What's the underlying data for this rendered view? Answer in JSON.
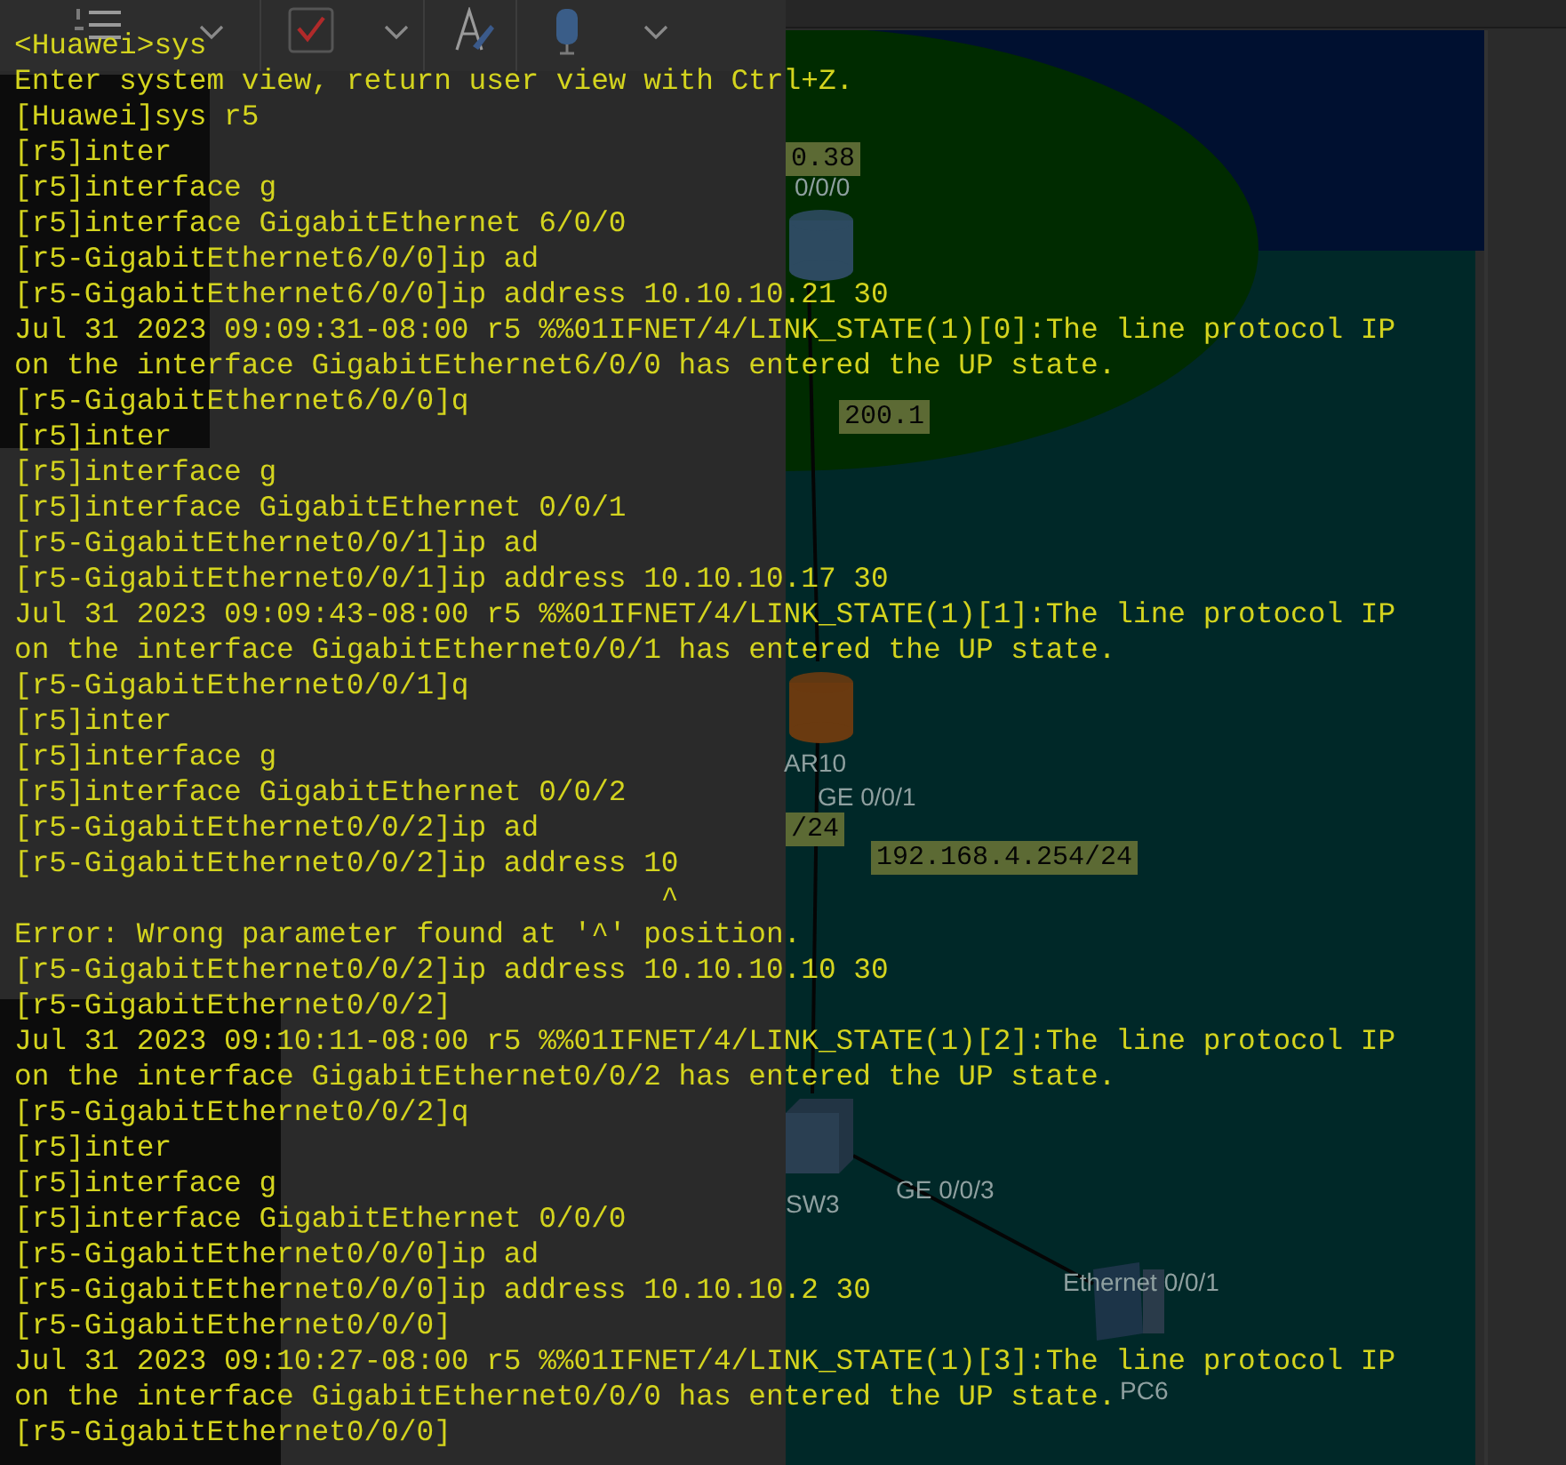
{
  "toolbar": {
    "items": [
      {
        "kind": "numbered-list"
      },
      {
        "kind": "caret"
      },
      {
        "kind": "checkbox"
      },
      {
        "kind": "caret"
      },
      {
        "kind": "brush"
      },
      {
        "kind": "microphone"
      },
      {
        "kind": "caret"
      }
    ]
  },
  "diagram": {
    "nodes": [
      {
        "kind": "router"
      },
      {
        "kind": "router"
      },
      {
        "kind": "switch"
      },
      {
        "kind": "pc"
      }
    ],
    "labels": [
      {
        "text": "0.38",
        "kind": "address"
      },
      {
        "text": "0/0/0",
        "kind": "port"
      },
      {
        "text": "200.1",
        "kind": "address"
      },
      {
        "text": "AR10",
        "kind": "name"
      },
      {
        "text": "GE 0/0/1",
        "kind": "port"
      },
      {
        "text": "/24",
        "kind": "address"
      },
      {
        "text": "192.168.4.254/24",
        "kind": "address"
      },
      {
        "text": "SW3",
        "kind": "name"
      },
      {
        "text": "GE 0/0/3",
        "kind": "port"
      },
      {
        "text": "Ethernet 0/0/1",
        "kind": "port"
      },
      {
        "text": "PC6",
        "kind": "name"
      }
    ]
  },
  "terminal": {
    "lines": [
      "<Huawei>sys",
      "Enter system view, return user view with Ctrl+Z.",
      "[Huawei]sys r5",
      "[r5]inter",
      "[r5]interface g",
      "[r5]interface GigabitEthernet 6/0/0",
      "[r5-GigabitEthernet6/0/0]ip ad",
      "[r5-GigabitEthernet6/0/0]ip address 10.10.10.21 30",
      "Jul 31 2023 09:09:31-08:00 r5 %%01IFNET/4/LINK_STATE(1)[0]:The line protocol IP",
      "on the interface GigabitEthernet6/0/0 has entered the UP state.",
      "[r5-GigabitEthernet6/0/0]q",
      "[r5]inter",
      "[r5]interface g",
      "[r5]interface GigabitEthernet 0/0/1",
      "[r5-GigabitEthernet0/0/1]ip ad",
      "[r5-GigabitEthernet0/0/1]ip address 10.10.10.17 30",
      "Jul 31 2023 09:09:43-08:00 r5 %%01IFNET/4/LINK_STATE(1)[1]:The line protocol IP",
      "on the interface GigabitEthernet0/0/1 has entered the UP state.",
      "[r5-GigabitEthernet0/0/1]q",
      "[r5]inter",
      "[r5]interface g",
      "[r5]interface GigabitEthernet 0/0/2",
      "[r5-GigabitEthernet0/0/2]ip ad",
      "[r5-GigabitEthernet0/0/2]ip address 10",
      "                                     ^",
      "Error: Wrong parameter found at '^' position.",
      "[r5-GigabitEthernet0/0/2]ip address 10.10.10.10 30",
      "[r5-GigabitEthernet0/0/2]",
      "Jul 31 2023 09:10:11-08:00 r5 %%01IFNET/4/LINK_STATE(1)[2]:The line protocol IP",
      "on the interface GigabitEthernet0/0/2 has entered the UP state.",
      "[r5-GigabitEthernet0/0/2]q",
      "[r5]inter",
      "[r5]interface g",
      "[r5]interface GigabitEthernet 0/0/0",
      "[r5-GigabitEthernet0/0/0]ip ad",
      "[r5-GigabitEthernet0/0/0]ip address 10.10.10.2 30",
      "[r5-GigabitEthernet0/0/0]",
      "Jul 31 2023 09:10:27-08:00 r5 %%01IFNET/4/LINK_STATE(1)[3]:The line protocol IP",
      "on the interface GigabitEthernet0/0/0 has entered the UP state.",
      "[r5-GigabitEthernet0/0/0]"
    ]
  }
}
